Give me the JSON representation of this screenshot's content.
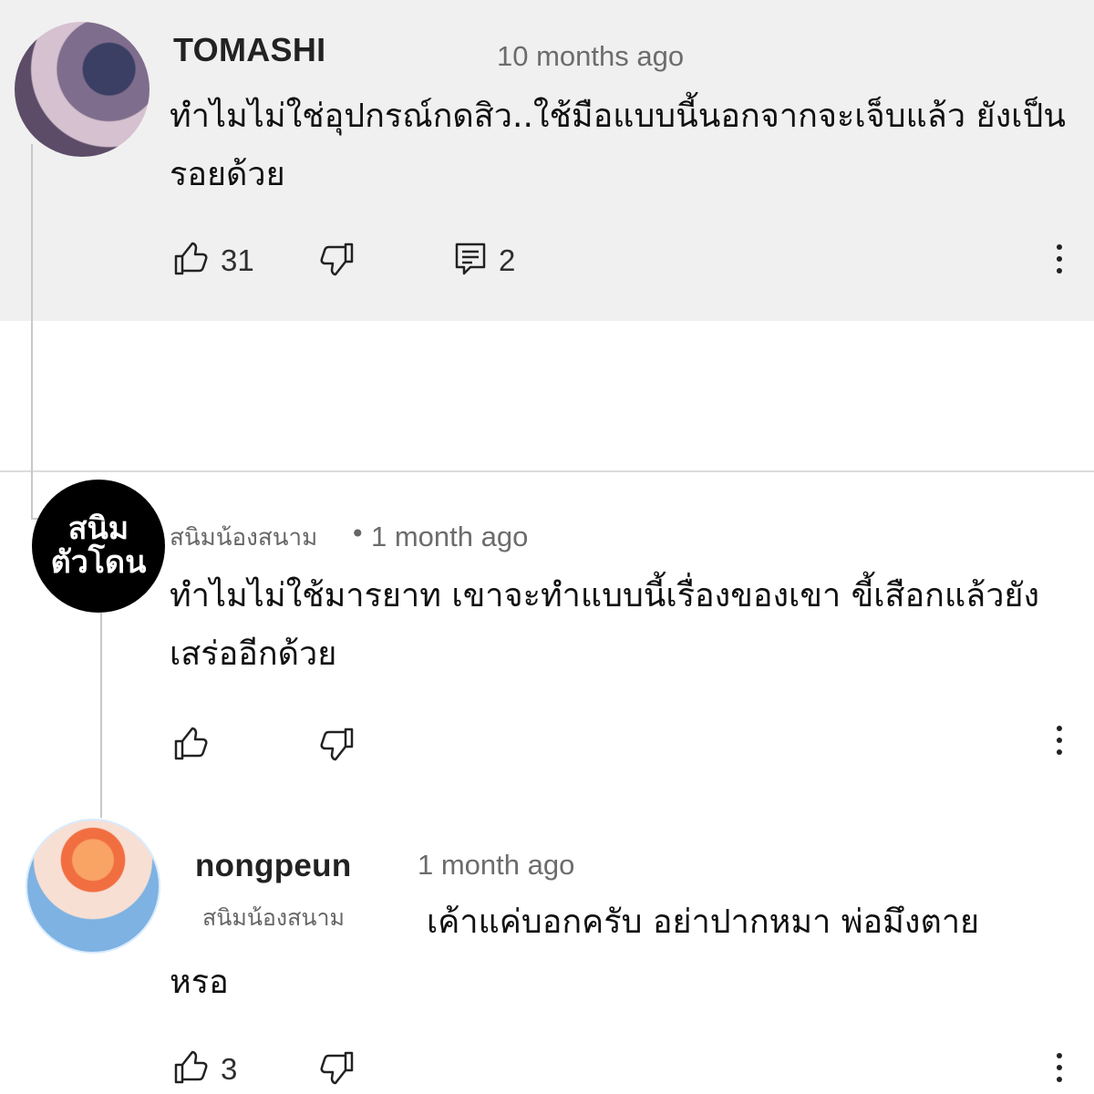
{
  "comment_1": {
    "author": "TOMASHI",
    "time": "10 months ago",
    "text": "ทำไมไม่ใช่อุปกรณ์กดสิว..ใช้มือแบบนี้นอกจากจะเจ็บแล้ว ยังเป็นรอยด้วย",
    "likes": "31",
    "replies": "2",
    "icons": {
      "like": "like-icon",
      "dislike": "dislike-icon",
      "reply": "reply-icon",
      "more": "more-options-icon"
    }
  },
  "comment_2": {
    "avatar_text_line1": "สนิม",
    "avatar_text_line2": "ตัวโดน",
    "author": "สนิมน้องสนาม",
    "separator": "•",
    "time": "1 month ago",
    "text": "ทำไมไม่ใช้มารยาท เขาจะทำแบบนี้เรื่องของเขา ขี้เสือกแล้วยังเสร่ออีกด้วย",
    "icons": {
      "like": "like-icon",
      "dislike": "dislike-icon",
      "more": "more-options-icon"
    }
  },
  "comment_3": {
    "author": "nongpeun",
    "time": "1 month ago",
    "mention": "สนิมน้องสนาม",
    "text_line1": "เค้าแค่บอกครับ อย่าปากหมา พ่อมึงตาย",
    "text_line2": "หรอ",
    "likes": "3",
    "icons": {
      "like": "like-icon",
      "dislike": "dislike-icon",
      "more": "more-options-icon"
    }
  },
  "colors": {
    "top_card_bg": "#f0f0f0",
    "divider": "#dcdcdc",
    "thread_line": "#c8c8c8",
    "secondary_text": "#6c6c6c"
  }
}
